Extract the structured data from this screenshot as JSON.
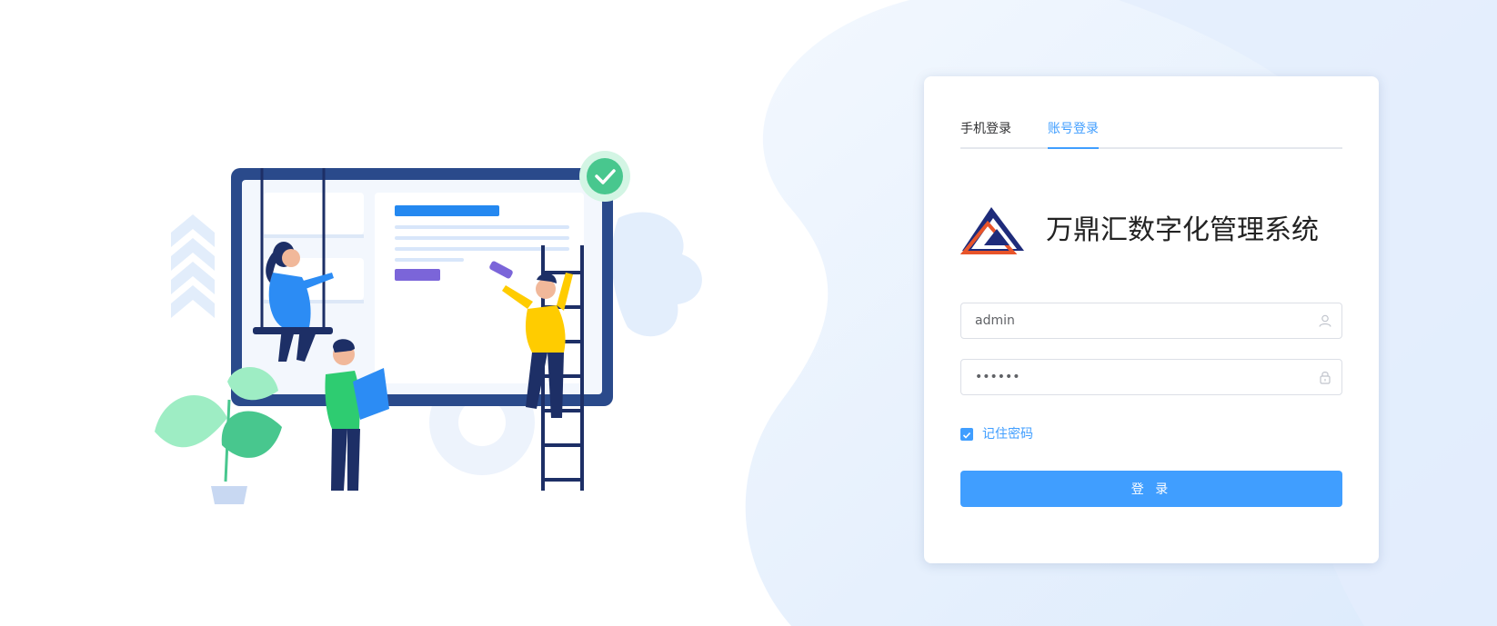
{
  "tabs": {
    "phone_login": "手机登录",
    "account_login": "账号登录",
    "active": "account_login"
  },
  "brand": {
    "title": "万鼎汇数字化管理系统",
    "logo": "triangle-logo-icon"
  },
  "form": {
    "username_value": "admin",
    "password_value": "••••••",
    "username_icon": "user-icon",
    "password_icon": "lock-icon",
    "remember_label": "记住密码",
    "remember_checked": true,
    "login_label": "登 录"
  },
  "colors": {
    "accent": "#409eff",
    "background_tint": "#e8f1fd"
  }
}
